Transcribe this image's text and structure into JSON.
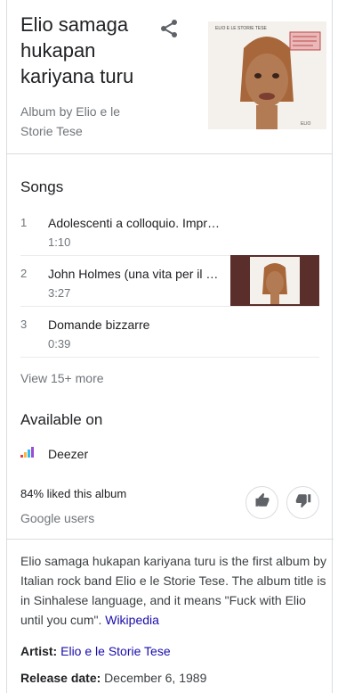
{
  "header": {
    "title": "Elio samaga hukapan kariyana turu",
    "subtitle": "Album by Elio e le Storie Tese",
    "cover_text": "ELIO E LE STORIE TESE"
  },
  "songs_section": {
    "title": "Songs",
    "items": [
      {
        "number": "1",
        "name": "Adolescenti a colloquio. Impr…",
        "duration": "1:10"
      },
      {
        "number": "2",
        "name": "John Holmes (una vita per il …",
        "duration": "3:27"
      },
      {
        "number": "3",
        "name": "Domande bizzarre",
        "duration": "0:39"
      }
    ],
    "more_label": "View 15+ more"
  },
  "available": {
    "title": "Available on",
    "provider": "Deezer"
  },
  "rating": {
    "liked": "84% liked this album",
    "source": "Google users"
  },
  "description": {
    "text": "Elio samaga hukapan kariyana turu is the first album by Italian rock band Elio e le Storie Tese. The album title is in Sinhalese language, and it means \"Fuck with Elio until you cum\".",
    "link": "Wikipedia"
  },
  "facts": {
    "artist_label": "Artist:",
    "artist_value": "Elio e le Storie Tese",
    "release_label": "Release date:",
    "release_value": "December 6, 1989"
  },
  "colors": {
    "text_primary": "#202124",
    "text_secondary": "#70757a",
    "link": "#1a0dab",
    "divider": "#dadce0",
    "thumb_bg": "#5a2f2b"
  },
  "icons": [
    "share-icon",
    "deezer-icon",
    "thumbs-up-icon",
    "thumbs-down-icon"
  ]
}
